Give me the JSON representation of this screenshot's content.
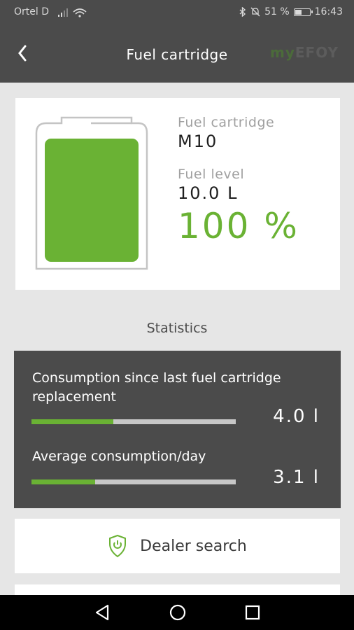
{
  "status_bar": {
    "carrier": "Ortel D",
    "battery_percent": "51 %",
    "battery_level": 0.51,
    "time": "16:43"
  },
  "header": {
    "title": "Fuel cartridge",
    "brand": {
      "my": "my",
      "rest": "EFOY"
    }
  },
  "fuel": {
    "cartridge_label": "Fuel cartridge",
    "cartridge_value": "M10",
    "level_label": "Fuel level",
    "level_value": "10.0 L",
    "percent": "100 %",
    "fill_fraction": 1.0
  },
  "statistics": {
    "title": "Statistics",
    "rows": [
      {
        "label_line1": "Consumption since last fuel cartridge",
        "label_line2": "replacement",
        "value": "4.0 l",
        "bar_fraction": 0.4
      },
      {
        "label": "Average consumption/day",
        "value": "3.1 l",
        "bar_fraction": 0.31
      }
    ]
  },
  "dealer_button": {
    "label": "Dealer search"
  },
  "colors": {
    "accent": "#6ab234",
    "dark": "#4b4b4b",
    "background": "#e6e6e6"
  }
}
